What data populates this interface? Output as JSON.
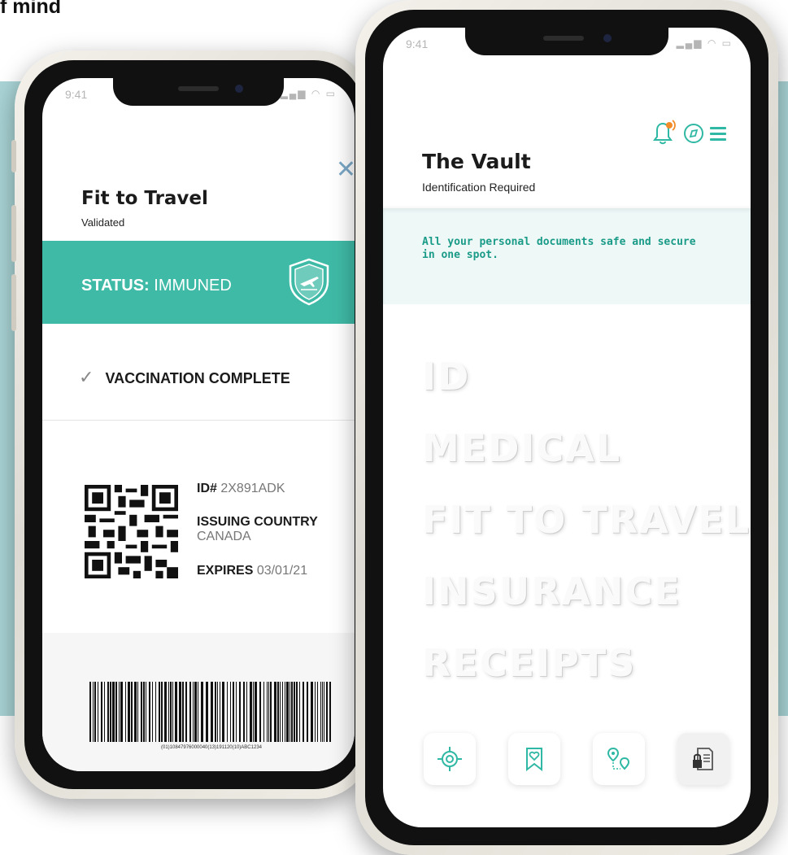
{
  "heading": "f mind",
  "left_phone": {
    "time": "9:41",
    "close_icon": "close-icon",
    "title": "Fit to Travel",
    "subtitle": "Validated",
    "status_label": "STATUS:",
    "status_value": "IMMUNED",
    "vaccination": "VACCINATION COMPLETE",
    "id_label": "ID#",
    "id_value": "2X891ADK",
    "country_label": "ISSUING COUNTRY",
    "country_value": "CANADA",
    "expires_label": "EXPIRES",
    "expires_value": "03/01/21",
    "barcode_number": "(01)10847976000040(13)191120(10)ABC1234",
    "colors": {
      "accent": "#3fbaa6"
    }
  },
  "right_phone": {
    "time": "9:41",
    "title": "The Vault",
    "subtitle": "Identification Required",
    "banner": "All your personal documents safe and secure in one spot.",
    "categories": [
      "ID",
      "MEDICAL",
      "FIT TO TRAVEL",
      "INSURANCE",
      "RECEIPTS"
    ],
    "icons": {
      "notification": "bell-icon",
      "compass": "compass-icon",
      "menu": "menu-icon"
    },
    "nav": [
      "target-icon",
      "bookmark-heart-icon",
      "route-icon",
      "locked-document-icon"
    ],
    "colors": {
      "accent": "#1a9b88",
      "banner_bg": "#eef8f7",
      "notify": "#f28c28"
    }
  }
}
